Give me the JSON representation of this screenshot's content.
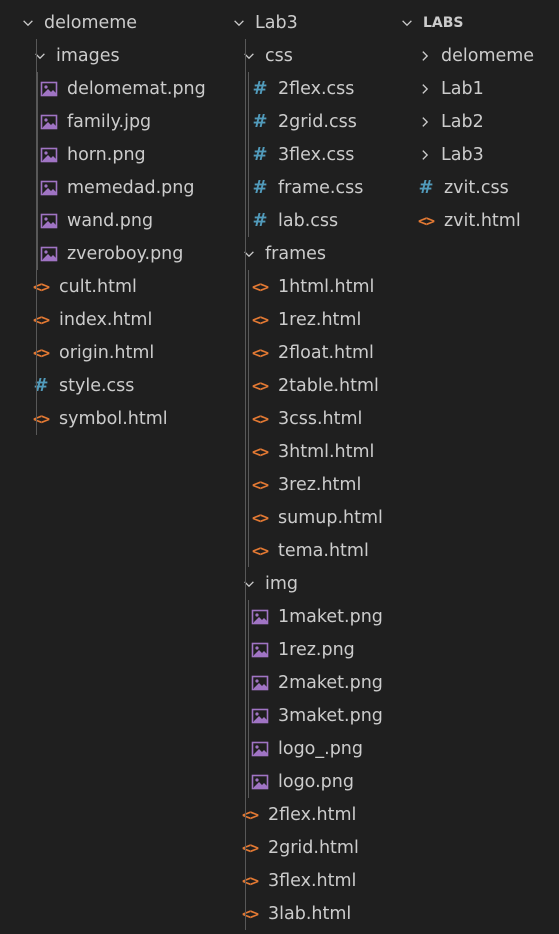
{
  "colors": {
    "background": "#1f1f1f",
    "text": "#cccccc",
    "css_icon": "#519aba",
    "html_icon": "#e37933",
    "image_icon": "#a074c4",
    "guide": "#585858"
  },
  "icons": {
    "folder_expanded": "chevron-down-icon",
    "folder_collapsed": "chevron-right-icon",
    "css": "hash-icon",
    "html": "code-brackets-icon",
    "image": "image-icon"
  },
  "panels": [
    {
      "root": "delomeme",
      "items": [
        {
          "label": "images",
          "kind": "folder",
          "expanded": true,
          "depth": 1
        },
        {
          "label": "delomemat.png",
          "kind": "image",
          "depth": 2
        },
        {
          "label": "family.jpg",
          "kind": "image",
          "depth": 2
        },
        {
          "label": "horn.png",
          "kind": "image",
          "depth": 2
        },
        {
          "label": "memedad.png",
          "kind": "image",
          "depth": 2
        },
        {
          "label": "wand.png",
          "kind": "image",
          "depth": 2
        },
        {
          "label": "zveroboy.png",
          "kind": "image",
          "depth": 2
        },
        {
          "label": "cult.html",
          "kind": "html",
          "depth": 1
        },
        {
          "label": "index.html",
          "kind": "html",
          "depth": 1
        },
        {
          "label": "origin.html",
          "kind": "html",
          "depth": 1
        },
        {
          "label": "style.css",
          "kind": "css",
          "depth": 1
        },
        {
          "label": "symbol.html",
          "kind": "html",
          "depth": 1
        }
      ]
    },
    {
      "root": "Lab3",
      "items": [
        {
          "label": "css",
          "kind": "folder",
          "expanded": true,
          "depth": 1
        },
        {
          "label": "2flex.css",
          "kind": "css",
          "depth": 2
        },
        {
          "label": "2grid.css",
          "kind": "css",
          "depth": 2
        },
        {
          "label": "3flex.css",
          "kind": "css",
          "depth": 2
        },
        {
          "label": "frame.css",
          "kind": "css",
          "depth": 2
        },
        {
          "label": "lab.css",
          "kind": "css",
          "depth": 2
        },
        {
          "label": "frames",
          "kind": "folder",
          "expanded": true,
          "depth": 1
        },
        {
          "label": "1html.html",
          "kind": "html",
          "depth": 2
        },
        {
          "label": "1rez.html",
          "kind": "html",
          "depth": 2
        },
        {
          "label": "2float.html",
          "kind": "html",
          "depth": 2
        },
        {
          "label": "2table.html",
          "kind": "html",
          "depth": 2
        },
        {
          "label": "3css.html",
          "kind": "html",
          "depth": 2
        },
        {
          "label": "3html.html",
          "kind": "html",
          "depth": 2
        },
        {
          "label": "3rez.html",
          "kind": "html",
          "depth": 2
        },
        {
          "label": "sumup.html",
          "kind": "html",
          "depth": 2
        },
        {
          "label": "tema.html",
          "kind": "html",
          "depth": 2
        },
        {
          "label": "img",
          "kind": "folder",
          "expanded": true,
          "depth": 1
        },
        {
          "label": "1maket.png",
          "kind": "image",
          "depth": 2
        },
        {
          "label": "1rez.png",
          "kind": "image",
          "depth": 2
        },
        {
          "label": "2maket.png",
          "kind": "image",
          "depth": 2
        },
        {
          "label": "3maket.png",
          "kind": "image",
          "depth": 2
        },
        {
          "label": "logo_.png",
          "kind": "image",
          "depth": 2
        },
        {
          "label": "logo.png",
          "kind": "image",
          "depth": 2
        },
        {
          "label": "2flex.html",
          "kind": "html",
          "depth": 1
        },
        {
          "label": "2grid.html",
          "kind": "html",
          "depth": 1
        },
        {
          "label": "3flex.html",
          "kind": "html",
          "depth": 1
        },
        {
          "label": "3lab.html",
          "kind": "html",
          "depth": 1
        }
      ]
    },
    {
      "root": "LABS",
      "items": [
        {
          "label": "delomeme",
          "kind": "folder",
          "expanded": false,
          "depth": 1
        },
        {
          "label": "Lab1",
          "kind": "folder",
          "expanded": false,
          "depth": 1
        },
        {
          "label": "Lab2",
          "kind": "folder",
          "expanded": false,
          "depth": 1
        },
        {
          "label": "Lab3",
          "kind": "folder",
          "expanded": false,
          "depth": 1
        },
        {
          "label": "zvit.css",
          "kind": "css",
          "depth": 1
        },
        {
          "label": "zvit.html",
          "kind": "html",
          "depth": 1
        }
      ]
    }
  ]
}
